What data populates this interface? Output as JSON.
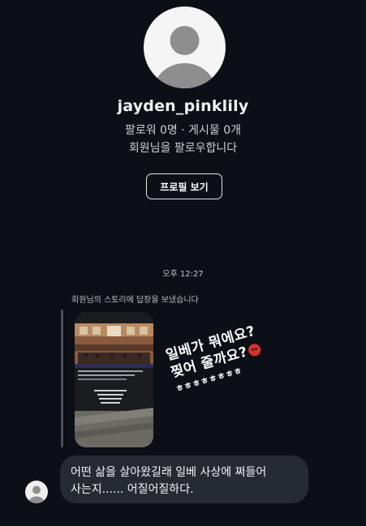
{
  "profile": {
    "avatar_icon": "default-avatar-icon",
    "username": "jayden_pinklily",
    "stats": "팔로워 0명 · 게시물 0개",
    "follow_note": "회원님을 팔로우합니다",
    "view_profile_label": "프로필 보기"
  },
  "conversation": {
    "timestamp": "오후 12:27",
    "story_reply": {
      "label": "회원님의 스토리에 답장을 보냈습니다",
      "story_text_lines": [
        "일베가 뭐에요?",
        "찢어 줄까요?",
        "ㅎㅎㅎㅎㅎㅎㅎㅎ"
      ],
      "emoji_icon": "angry-face-icon"
    },
    "message": {
      "sender_avatar_icon": "default-avatar-icon",
      "text": "어떤 삶을 살아왔길래 일베 사상에 쩌들어 사는지...... 어질어질하다."
    }
  },
  "colors": {
    "background": "#0c0f16",
    "bubble": "#262a33",
    "avatar_bg": "#f5f5f5",
    "avatar_fg": "#8e8e8e"
  }
}
